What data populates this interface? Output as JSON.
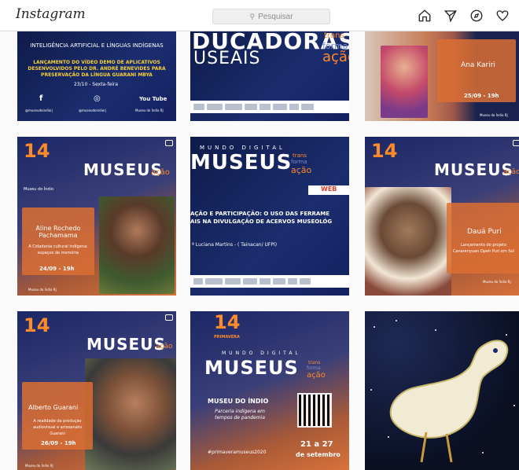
{
  "app": {
    "logo": "Instagram"
  },
  "search": {
    "placeholder": "Pesquisar",
    "icon": "search-icon"
  },
  "nav_icons": [
    "home-icon",
    "direct-icon",
    "explore-icon",
    "heart-icon",
    "avatar"
  ],
  "colors": {
    "accent_orange": "#ff8a2a",
    "navy": "#0e1b4a"
  },
  "posts": {
    "p1": {
      "heading": "INTELIGÊNCIA ARTIFICIAL E LÍNGUAS INDÍGENAS",
      "body": "LANÇAMENTO DO VÍDEO DEMO DE APLICATIVOS DESENVOLVIDOS PELO DR. ANDRÉ BENEVIDES PARA PRESERVAÇÃO DA LÍNGUA GUARANI MBYA",
      "date": "23/10 - Sexta-feira",
      "handle1": "@museudoindiorj",
      "handle2": "@museudoindiorj",
      "handle3": "Museu do Índio RJ",
      "yt": "You Tube"
    },
    "p2": {
      "big": "DUCADORAS",
      "sub": "USEAIS",
      "trans": "trans",
      "forma": "forma",
      "acao": "ação"
    },
    "p3": {
      "name": "Ana Kariri",
      "date": "25/09 - 19h",
      "footer": "Museu do Índio RJ"
    },
    "p4": {
      "num": "14",
      "title": "MUSEUS",
      "suffix": "ação",
      "host": "Museu do Índio",
      "name": "Aline Rochedo Pachamama",
      "desc": "A Cidadania cultural indígena: espaços de memória",
      "date": "24/09 - 19h",
      "footer": "Museu do Índio RJ"
    },
    "p5": {
      "small": "MUNDO DIGITAL",
      "title": "MUSEUS",
      "trans": "trans",
      "forma": "forma",
      "acao": "ação",
      "tag": "WEB",
      "line1": "AÇÃO E PARTICIPAÇÃO: O USO DAS  FERRAME",
      "line2": "AIS NA DIVULGAÇÃO DE ACERVOS MUSEOLÓG",
      "speaker": "ª Luciana Martins - ( Tainacan/ UFPI)"
    },
    "p6": {
      "num": "14",
      "title": "MUSEUS",
      "suffix": "ação",
      "name": "Dauá Puri",
      "desc": "Lançamento do projeto Canarenyuan Opeh Puri em Sol",
      "footer": "Museu do Índio RJ"
    },
    "p7": {
      "num": "14",
      "title": "MUSEUS",
      "suffix": "ação",
      "name": "Alberto Guarani",
      "desc": "A realidade da produção audiovisual e artesanato Guarani",
      "date": "26/09 - 19h",
      "footer": "Museu do Índio RJ"
    },
    "p8": {
      "num": "14",
      "primavera": "PRIMAVERA",
      "small": "MUNDO DIGITAL",
      "title": "MUSEUS",
      "trans": "trans",
      "forma": "forma",
      "acao": "ação",
      "museu": "MUSEU DO ÍNDIO",
      "parceria": "Parceria indígena em tempos de pandemia",
      "hashtag": "#primaveramuseus2020",
      "dates": "21 a 27",
      "month": "de setembro"
    },
    "p9": {
      "description": "bird painting"
    }
  }
}
